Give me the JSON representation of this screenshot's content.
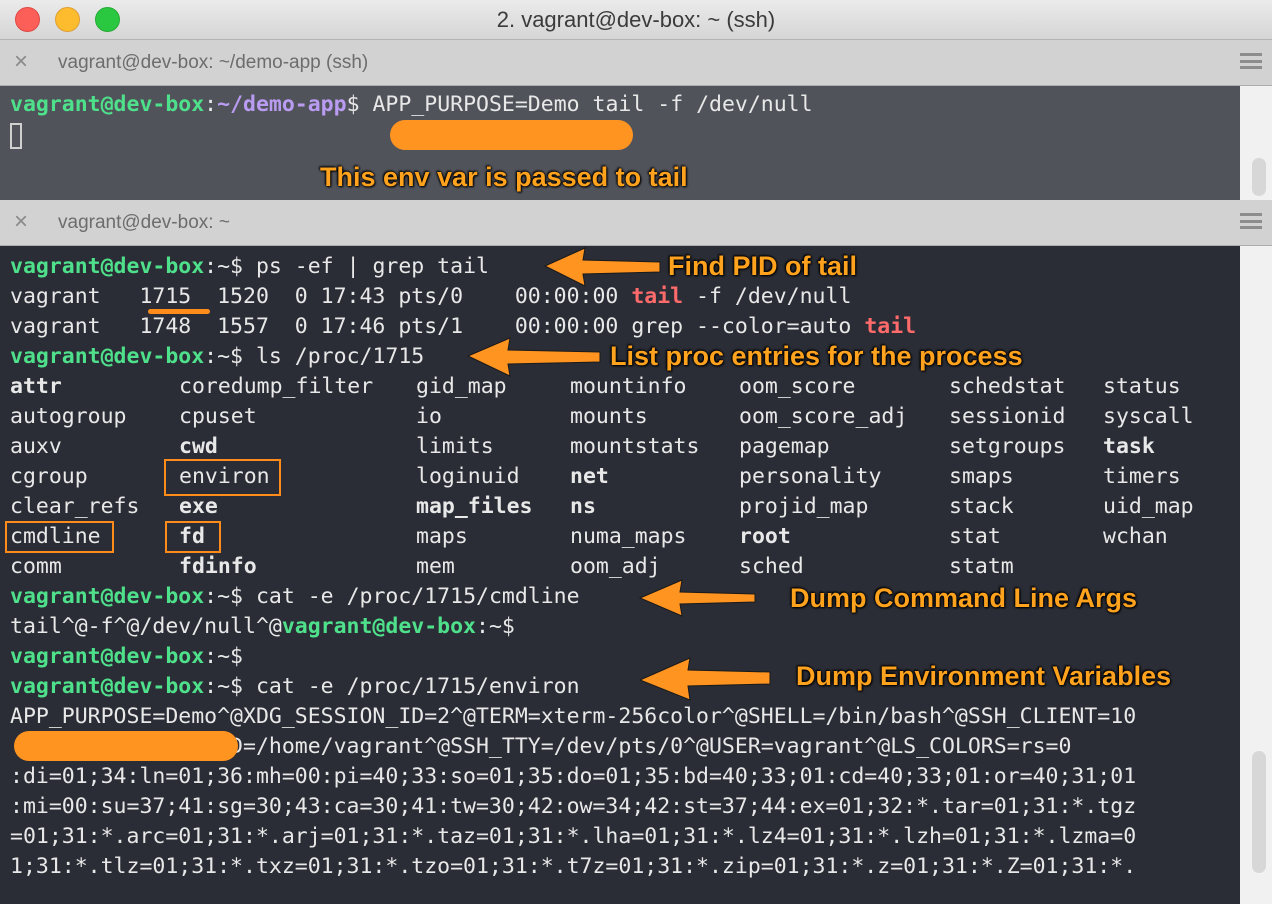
{
  "window": {
    "title": "2. vagrant@dev-box: ~ (ssh)"
  },
  "tabs": [
    {
      "title": "vagrant@dev-box: ~/demo-app (ssh)",
      "close": "×"
    },
    {
      "title": "vagrant@dev-box: ~",
      "close": "×"
    }
  ],
  "top_pane": {
    "prompt_user": "vagrant@dev-box",
    "prompt_path": "~/demo-app",
    "prompt_sym": "$",
    "command": " APP_PURPOSE=Demo tail -f /dev/null"
  },
  "bottom_pane": {
    "prompt_user": "vagrant@dev-box",
    "prompt_home": ":~$",
    "cmd_ps": " ps -ef | grep tail",
    "ps_row1_pre": "vagrant   1715  1520  0 17:43 pts/0    00:00:00 ",
    "ps_row1_hl": "tail",
    "ps_row1_post": " -f /dev/null",
    "ps_row2_pre": "vagrant   1748  1557  0 17:46 pts/1    00:00:00 grep --color=auto ",
    "ps_row2_hl": "tail",
    "cmd_ls": " ls /proc/1715",
    "ls_columns": [
      [
        "attr",
        "autogroup",
        "auxv",
        "cgroup",
        "clear_refs",
        "cmdline",
        "comm"
      ],
      [
        "coredump_filter",
        "cpuset",
        "cwd",
        "environ",
        "exe",
        "fd",
        "fdinfo"
      ],
      [
        "gid_map",
        "io",
        "limits",
        "loginuid",
        "map_files",
        "maps",
        "mem"
      ],
      [
        "mountinfo",
        "mounts",
        "mountstats",
        "net",
        "ns",
        "numa_maps",
        "oom_adj"
      ],
      [
        "oom_score",
        "oom_score_adj",
        "pagemap",
        "personality",
        "projid_map",
        "root",
        "sched"
      ],
      [
        "schedstat",
        "sessionid",
        "setgroups",
        "smaps",
        "stack",
        "stat",
        "statm"
      ],
      [
        "status",
        "syscall",
        "task",
        "timers",
        "uid_map",
        "wchan"
      ]
    ],
    "cmd_cat_cmdline": " cat -e /proc/1715/cmdline",
    "cmdline_output": "tail^@-f^@/dev/null^@",
    "cmd_cat_environ": " cat -e /proc/1715/environ",
    "environ_lines": [
      "APP_PURPOSE=Demo^@XDG_SESSION_ID=2^@TERM=xterm-256color^@SHELL=/bin/bash^@SSH_CLIENT=10",
      "           @OLDPWD=/home/vagrant^@SSH_TTY=/dev/pts/0^@USER=vagrant^@LS_COLORS=rs=0",
      ":di=01;34:ln=01;36:mh=00:pi=40;33:so=01;35:do=01;35:bd=40;33;01:cd=40;33;01:or=40;31;01",
      ":mi=00:su=37;41:sg=30;43:ca=30;41:tw=30;42:ow=34;42:st=37;44:ex=01;32:*.tar=01;31:*.tgz",
      "=01;31:*.arc=01;31:*.arj=01;31:*.taz=01;31:*.lha=01;31:*.lz4=01;31:*.lzh=01;31:*.lzma=0",
      "1;31:*.tlz=01;31:*.txz=01;31:*.tzo=01;31:*.t7z=01;31:*.zip=01;31:*.z=01;31:*.Z=01;31:*."
    ]
  },
  "annotations": {
    "env_passed": "This env var is passed to tail",
    "find_pid": "Find PID of tail",
    "list_proc": "List proc entries for the process",
    "dump_cmdline": "Dump Command Line Args",
    "dump_env": "Dump Environment Variables"
  },
  "colors": {
    "prompt_user": "#4ee08a",
    "prompt_path": "#b99cf1",
    "directory": "#b99cf1",
    "symlink": "#5fd2f0",
    "grep_match": "#ff6a6a",
    "annotation": "#ffa21d"
  }
}
